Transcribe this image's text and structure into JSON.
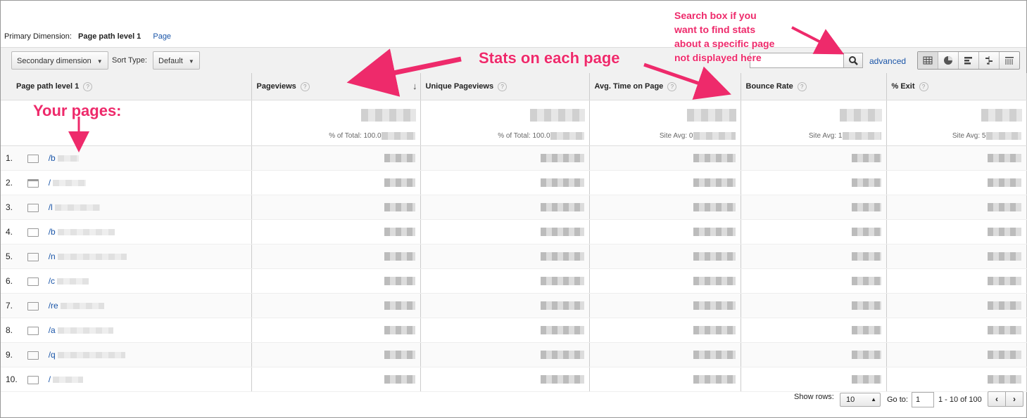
{
  "primary_dimension": {
    "label": "Primary Dimension:",
    "active": "Page path level 1",
    "other": "Page"
  },
  "toolbar": {
    "secondary_dimension": "Secondary dimension",
    "sort_type_label": "Sort Type:",
    "sort_type_value": "Default",
    "advanced": "advanced",
    "view_icons": [
      "table-view-icon",
      "pie-view-icon",
      "bar-view-icon",
      "comparison-view-icon",
      "pivot-view-icon"
    ]
  },
  "table": {
    "columns": [
      "Page path level 1",
      "Pageviews",
      "Unique Pageviews",
      "Avg. Time on Page",
      "Bounce Rate",
      "% Exit"
    ],
    "summary": [
      "% of Total: 100.0",
      "% of Total: 100.0",
      "Site Avg: 0",
      "Site Avg: 1",
      "Site Avg: 5"
    ],
    "rows": [
      {
        "num": "1.",
        "path": "/b",
        "icon": "folder-icon"
      },
      {
        "num": "2.",
        "path": "/",
        "icon": "page-icon"
      },
      {
        "num": "3.",
        "path": "/l",
        "icon": "folder-icon"
      },
      {
        "num": "4.",
        "path": "/b",
        "icon": "folder-icon"
      },
      {
        "num": "5.",
        "path": "/n",
        "icon": "folder-icon"
      },
      {
        "num": "6.",
        "path": "/c",
        "icon": "folder-icon"
      },
      {
        "num": "7.",
        "path": "/re",
        "icon": "folder-icon"
      },
      {
        "num": "8.",
        "path": "/a",
        "icon": "folder-icon"
      },
      {
        "num": "9.",
        "path": "/q",
        "icon": "folder-icon"
      },
      {
        "num": "10.",
        "path": "/",
        "icon": "folder-icon"
      }
    ]
  },
  "footer": {
    "show_rows_label": "Show rows:",
    "show_rows_value": "10",
    "goto_label": "Go to:",
    "goto_value": "1",
    "range": "1 - 10 of 100",
    "prev": "‹",
    "next": "›"
  },
  "annotations": {
    "stats": "Stats on each page",
    "pages": "Your pages:",
    "search_line1": "Search box if you",
    "search_line2": "want to find stats",
    "search_line3": "about a specific page",
    "search_line4": "not displayed here"
  },
  "colors": {
    "annotation": "#ee2a6b",
    "link": "#1a55a8",
    "header_bg": "#f1f1f1"
  }
}
